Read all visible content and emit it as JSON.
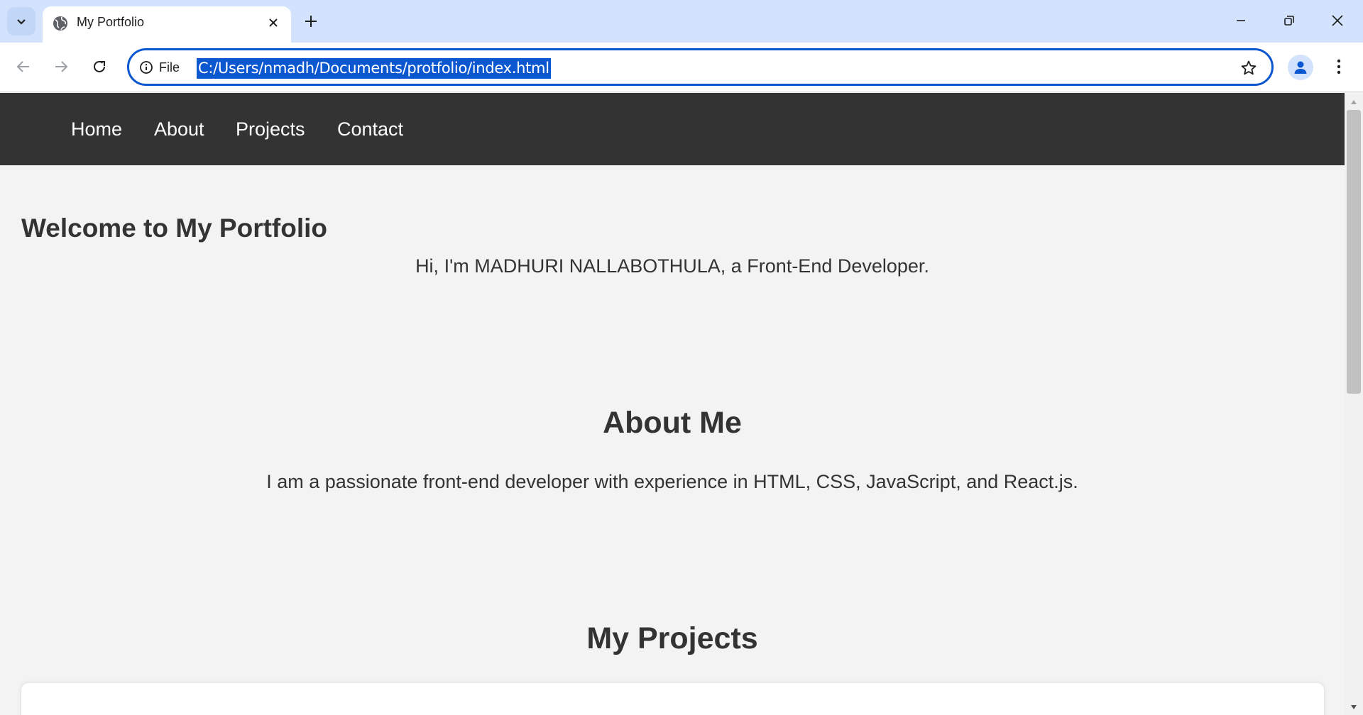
{
  "browser": {
    "tab": {
      "title": "My Portfolio",
      "favicon": "globe-icon"
    },
    "address_bar": {
      "security_label": "File",
      "url": "C:/Users/nmadh/Documents/protfolio/index.html"
    },
    "colors": {
      "tabstrip": "#d3e3fd",
      "focus_ring": "#0b57d0"
    }
  },
  "page": {
    "nav": {
      "links": [
        "Home",
        "About",
        "Projects",
        "Contact"
      ]
    },
    "hero": {
      "title": "Welcome to My Portfolio",
      "text": "Hi, I'm MADHURI NALLABOTHULA, a Front-End Developer."
    },
    "about": {
      "title": "About Me",
      "text": "I am a passionate front-end developer with experience in HTML, CSS, JavaScript, and React.js."
    },
    "projects": {
      "title": "My Projects"
    },
    "colors": {
      "nav_bg": "#333333",
      "text": "#333333",
      "page_bg": "#f3f3f3"
    }
  }
}
